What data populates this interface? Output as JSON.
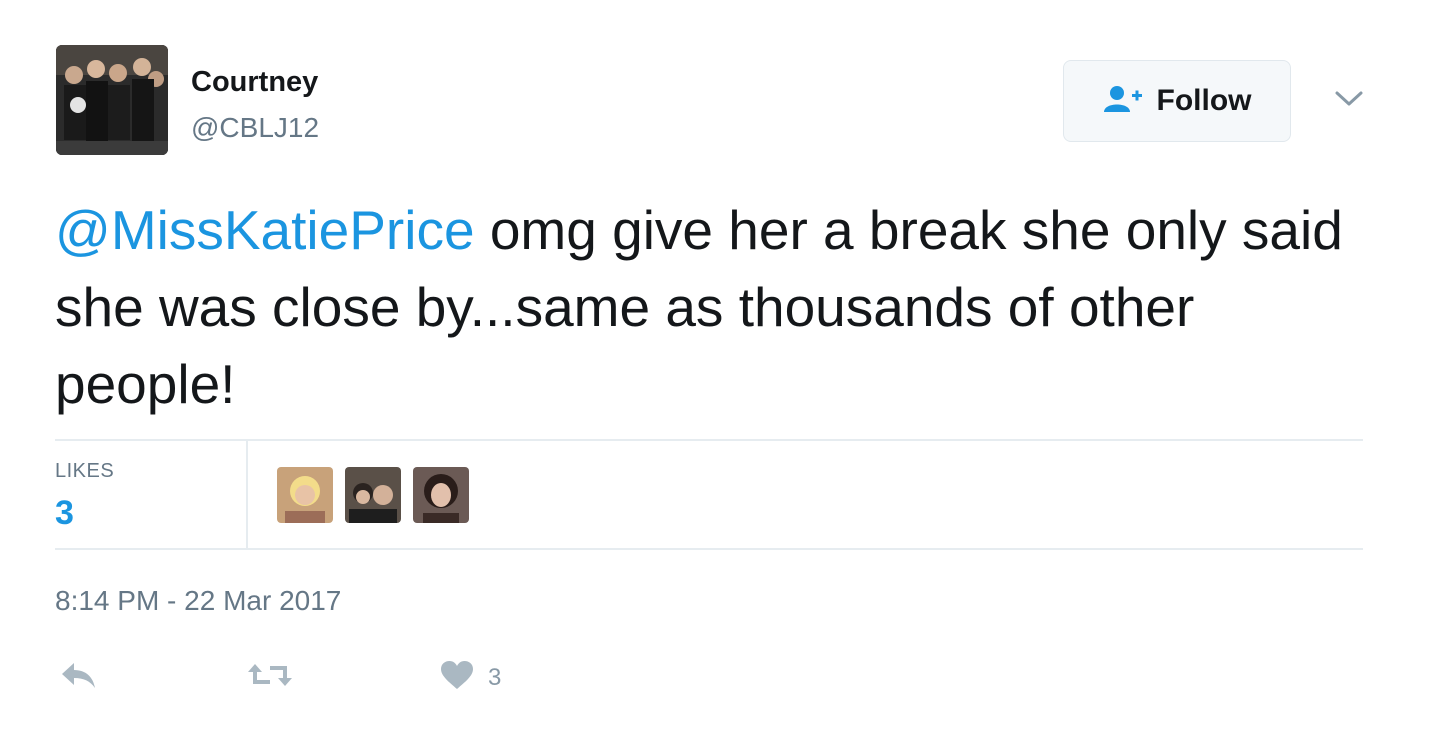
{
  "author": {
    "name": "Courtney",
    "handle": "@CBLJ12"
  },
  "follow_button": {
    "label": "Follow",
    "icon": "follow-user-icon"
  },
  "tweet": {
    "mention": "@MissKatiePrice",
    "text": " omg give her a break she only said she was close by...same as thousands of other people!"
  },
  "stats": {
    "likes_label": "LIKES",
    "likes_count": "3"
  },
  "timestamp": "8:14 PM - 22 Mar 2017",
  "actions": {
    "reply_icon": "reply-icon",
    "retweet_icon": "retweet-icon",
    "like_icon": "heart-icon",
    "like_count": "3"
  },
  "colors": {
    "accent": "#1b95e0",
    "secondary_text": "#657786",
    "divider": "#e6ecf0",
    "action_icon": "#aab8c2"
  }
}
